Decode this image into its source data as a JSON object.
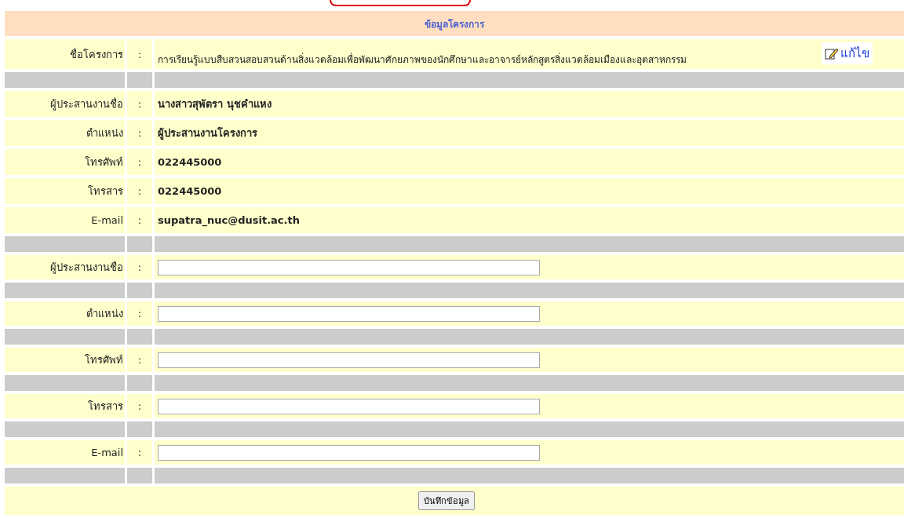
{
  "header": {
    "title": "ข้อมูลโครงการ"
  },
  "project": {
    "label": "ชื่อโครงการ",
    "separator": ":",
    "value": "การเรียนรู้แบบสืบสวนสอบสวนด้านสิ่งแวดล้อมเพื่อพัฒนาศักยภาพของนักศึกษาและอาจารย์หลักสูตรสิ่งแวดล้อมเมืองและอุตสาหกรรม",
    "edit_label": "แก้ไข"
  },
  "info_rows": [
    {
      "label": "ผู้ประสานงานชื่อ",
      "separator": ":",
      "value": "นางสาวสุพัตรา นุชคำแหง"
    },
    {
      "label": "ตำแหน่ง",
      "separator": ":",
      "value": "ผู้ประสานงานโครงการ"
    },
    {
      "label": "โทรศัพท์",
      "separator": ":",
      "value": "022445000"
    },
    {
      "label": "โทรสาร",
      "separator": ":",
      "value": "022445000"
    },
    {
      "label": "E-mail",
      "separator": ":",
      "value": "supatra_nuc@dusit.ac.th"
    }
  ],
  "form_fields": [
    {
      "label": "ผู้ประสานงานชื่อ",
      "separator": ":"
    },
    {
      "label": "ตำแหน่ง",
      "separator": ":"
    },
    {
      "label": "โทรศัพท์",
      "separator": ":"
    },
    {
      "label": "โทรสาร",
      "separator": ":"
    },
    {
      "label": "E-mail",
      "separator": ":"
    }
  ],
  "save_button": "บันทึกข้อมูล"
}
